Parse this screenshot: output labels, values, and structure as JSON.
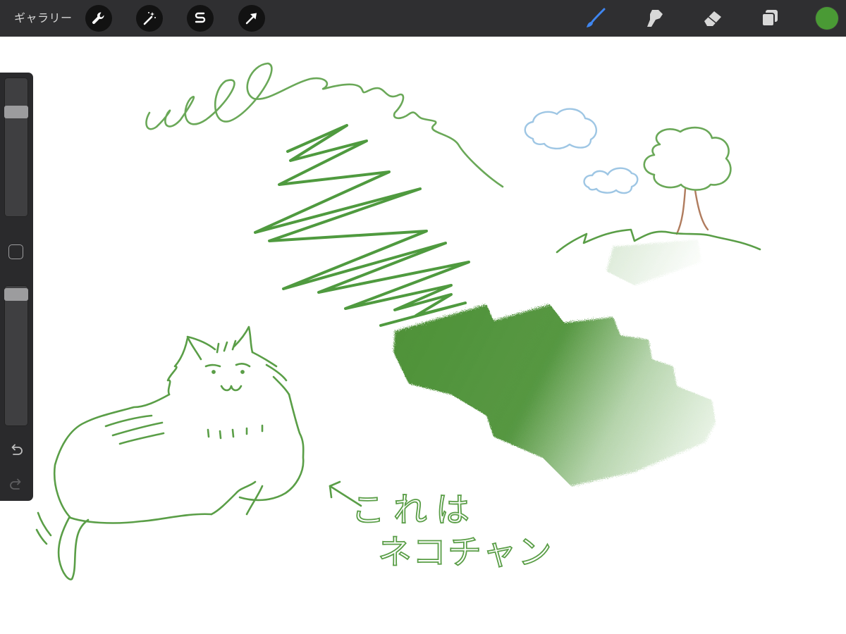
{
  "topbar": {
    "gallery_label": "ギャラリー",
    "left_tools": [
      "wrench-icon",
      "magic-wand-icon",
      "selection-icon",
      "transform-arrow-icon"
    ],
    "right_tools": [
      "brush-icon",
      "smudge-icon",
      "eraser-icon",
      "layers-icon"
    ],
    "active_tool": "brush",
    "current_color": "#4a9a35"
  },
  "sidebar": {
    "brush_size_slider": 0.12,
    "opacity_slider": 0.04,
    "undo_icon": "undo-icon",
    "redo_icon": "redo-icon"
  },
  "canvas": {
    "handwriting_line1": "これは",
    "handwriting_line2": "ネコチャン",
    "colors": {
      "stroke_green": "#5a9e47",
      "fill_green": "#4e9238",
      "cloud_blue": "#9ec6e4",
      "trunk_brown": "#b07c5e"
    }
  }
}
